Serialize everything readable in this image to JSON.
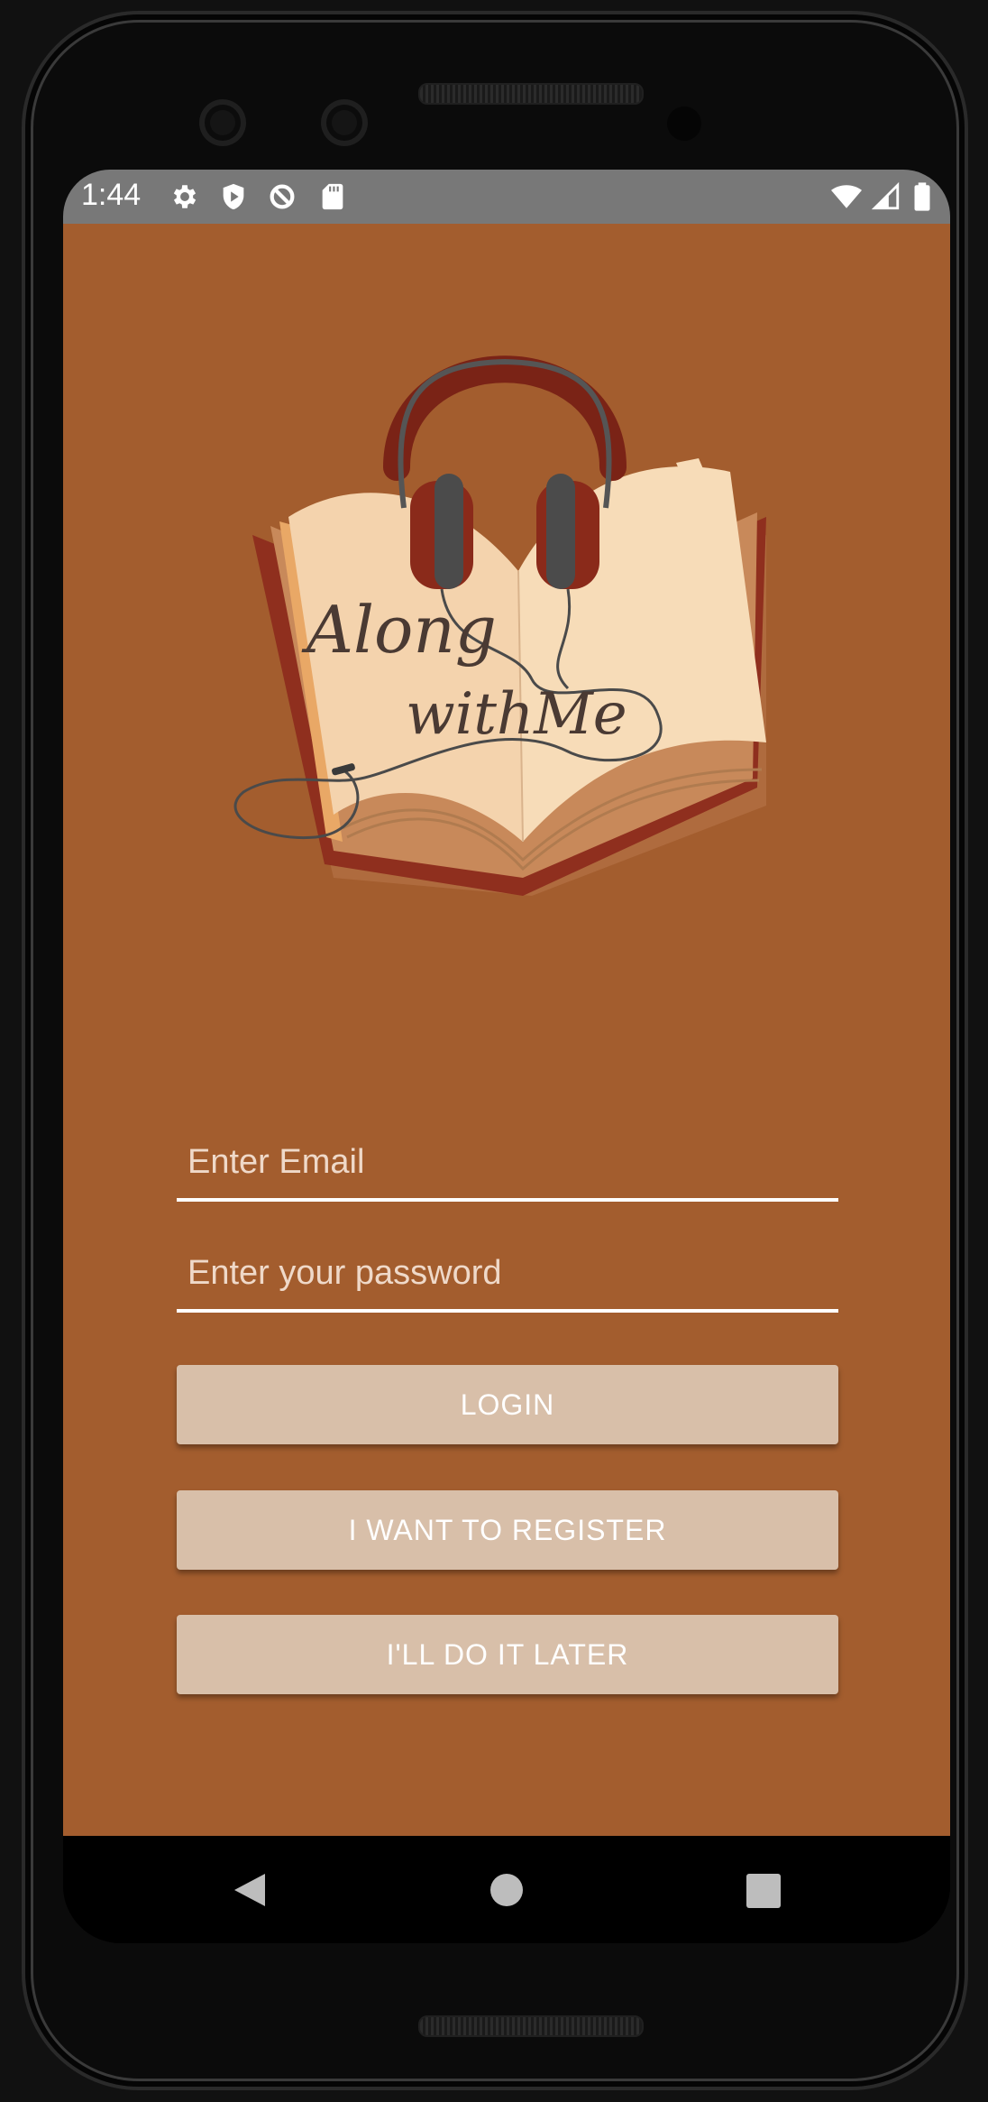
{
  "status_bar": {
    "time": "1:44",
    "left_icons": [
      "settings-gear-icon",
      "shield-icon",
      "sync-icon",
      "sd-card-icon"
    ],
    "right_icons": [
      "wifi-icon",
      "cell-signal-icon",
      "battery-icon"
    ]
  },
  "logo": {
    "text_line1": "Along",
    "text_line2": "withMe",
    "icon": "headphones-book-icon"
  },
  "form": {
    "email_placeholder": "Enter Email",
    "email_value": "",
    "password_placeholder": "Enter your password",
    "password_value": ""
  },
  "buttons": {
    "login": "LOGIN",
    "register": "I WANT TO REGISTER",
    "later": "I'LL DO IT LATER"
  },
  "nav_bar": {
    "icons": [
      "back-icon",
      "home-icon",
      "recents-icon"
    ]
  },
  "colors": {
    "background": "#a35d2e",
    "button": "#d8bfa9",
    "status_bar": "#787878"
  }
}
